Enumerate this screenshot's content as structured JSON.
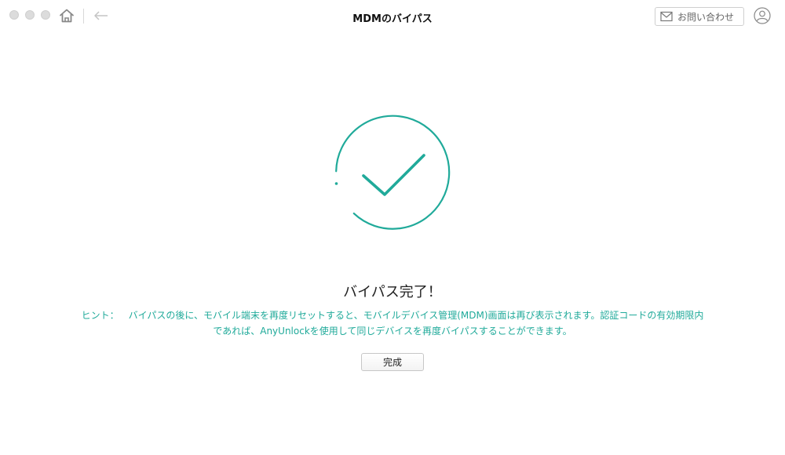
{
  "window": {
    "title": "MDMのバイパス"
  },
  "toolbar": {
    "home_icon": "home-icon",
    "back_icon": "back-arrow-icon",
    "contact_label": "お問い合わせ",
    "contact_icon": "mail-icon",
    "user_icon": "user-icon"
  },
  "main": {
    "status_icon": "checkmark-circle-icon",
    "heading": "バイパス完了！",
    "hint_label": "ヒント：",
    "hint_line1": "バイパスの後に、モバイル端末を再度リセットすると、モバイルデバイス管理(MDM)画面は再び表示されます。認証コードの有効期限内",
    "hint_line2": "であれば、AnyUnlockを使用して同じデバイスを再度バイパスすることができます。",
    "done_label": "完成"
  },
  "colors": {
    "accent": "#20aa9a",
    "traffic_light": "#dcdcdc",
    "icon_gray": "#888888"
  }
}
